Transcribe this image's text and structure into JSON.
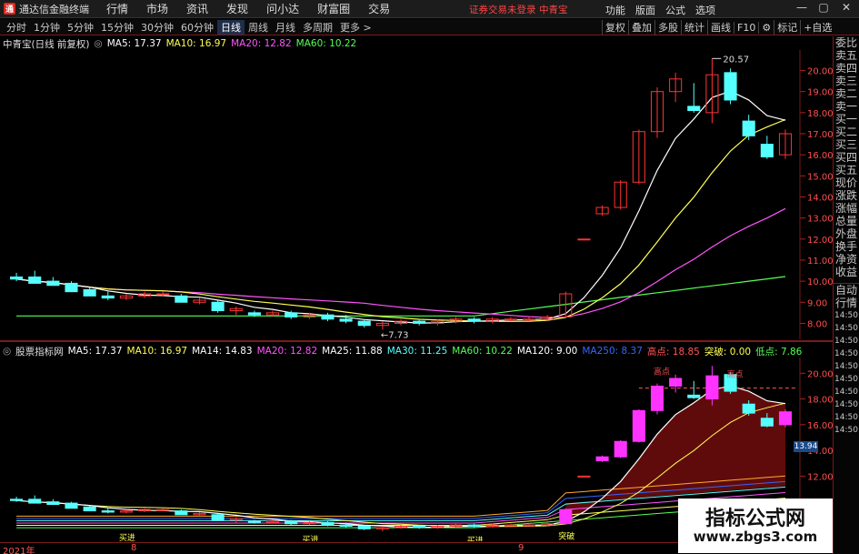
{
  "titlebar": {
    "app_name": "通达信金融终端",
    "menu": [
      "行情",
      "市场",
      "资讯",
      "发现",
      "问小达",
      "财富圈",
      "交易"
    ],
    "notice": "证券交易未登录",
    "stock": "中青宝",
    "right_menu": [
      "功能",
      "版面",
      "公式",
      "选项"
    ],
    "min": "—",
    "max": "▢",
    "close": "✕"
  },
  "toolbar": {
    "periods": [
      "分时",
      "1分钟",
      "5分钟",
      "15分钟",
      "30分钟",
      "60分钟",
      "日线",
      "周线",
      "月线",
      "多周期",
      "更多 >"
    ],
    "active_period": "日线",
    "tools": [
      "复权",
      "叠加",
      "多股",
      "统计",
      "画线",
      "F10",
      "标记",
      "+自选"
    ]
  },
  "right_panel": {
    "top": [
      "委比",
      "卖五",
      "卖四",
      "卖三",
      "卖二",
      "卖一",
      "买一",
      "买二",
      "买三",
      "买四",
      "买五",
      "现价",
      "涨跌",
      "涨幅",
      "总量",
      "外盘",
      "换手",
      "净资",
      "收益"
    ],
    "bottom": [
      "自动",
      "行情",
      "14:50",
      "14:50",
      "14:50",
      "14:50",
      "14:50",
      "14:50",
      "14:50",
      "14:50",
      "14:50",
      "14:50"
    ]
  },
  "main_legend": {
    "title": "中青宝(日线 前复权)",
    "ma5": "MA5: 17.37",
    "ma10": "MA10: 16.97",
    "ma20": "MA20: 12.82",
    "ma60": "MA60: 10.22"
  },
  "sub_legend": {
    "title": "股票指标网",
    "items": [
      {
        "text": "MA5: 17.37",
        "color": "#ffffff"
      },
      {
        "text": "MA10: 16.97",
        "color": "#ffff55"
      },
      {
        "text": "MA14: 14.83",
        "color": "#ffffff"
      },
      {
        "text": "MA20: 12.82",
        "color": "#ff55ff"
      },
      {
        "text": "MA25: 11.88",
        "color": "#ffffff"
      },
      {
        "text": "MA30: 11.25",
        "color": "#55ffff"
      },
      {
        "text": "MA60: 10.22",
        "color": "#55ff55"
      },
      {
        "text": "MA120: 9.00",
        "color": "#ffffff"
      },
      {
        "text": "MA250: 8.37",
        "color": "#3366ff"
      },
      {
        "text": "高点: 18.85",
        "color": "#ff5555"
      },
      {
        "text": "突破: 0.00",
        "color": "#ffff55"
      },
      {
        "text": "低点: 7.86",
        "color": "#55ff55"
      }
    ]
  },
  "main_axis": [
    "20.00",
    "19.00",
    "18.00",
    "17.00",
    "16.00",
    "15.00",
    "14.00",
    "13.00",
    "12.00",
    "11.00",
    "10.00",
    "9.00",
    "8.00"
  ],
  "sub_axis": [
    "20.00",
    "18.00",
    "16.00",
    "14.00",
    "12.00"
  ],
  "sub_value_box": "13.94",
  "annotations": {
    "high": "20.57",
    "low": "7.73",
    "high_mark": "高点",
    "breakout": "突破",
    "buy": "买进"
  },
  "time_axis": [
    "2021年",
    "8",
    "9"
  ],
  "watermark": {
    "line1": "指标公式网",
    "line2": "www.zbgs3.com"
  },
  "chart_data": {
    "type": "candlestick",
    "title": "中青宝(日线 前复权)",
    "ylim": [
      7.5,
      20.8
    ],
    "candles": [
      [
        10.2,
        10.4,
        10.0,
        10.1
      ],
      [
        10.2,
        10.5,
        9.9,
        9.9
      ],
      [
        10.0,
        10.2,
        9.8,
        9.8
      ],
      [
        9.9,
        10.0,
        9.5,
        9.5
      ],
      [
        9.6,
        9.7,
        9.3,
        9.3
      ],
      [
        9.3,
        9.5,
        9.1,
        9.2
      ],
      [
        9.2,
        9.4,
        9.1,
        9.3
      ],
      [
        9.3,
        9.5,
        9.2,
        9.4
      ],
      [
        9.4,
        9.5,
        9.3,
        9.4
      ],
      [
        9.3,
        9.4,
        9.0,
        9.0
      ],
      [
        9.0,
        9.2,
        8.9,
        9.1
      ],
      [
        9.0,
        9.1,
        8.5,
        8.6
      ],
      [
        8.6,
        8.8,
        8.4,
        8.7
      ],
      [
        8.5,
        8.6,
        8.3,
        8.4
      ],
      [
        8.4,
        8.6,
        8.3,
        8.5
      ],
      [
        8.5,
        8.6,
        8.2,
        8.3
      ],
      [
        8.3,
        8.5,
        8.2,
        8.4
      ],
      [
        8.4,
        8.5,
        8.1,
        8.2
      ],
      [
        8.2,
        8.4,
        8.0,
        8.1
      ],
      [
        8.1,
        8.2,
        7.8,
        7.9
      ],
      [
        7.9,
        8.1,
        7.7,
        8.0
      ],
      [
        8.0,
        8.2,
        7.9,
        8.1
      ],
      [
        8.1,
        8.2,
        7.9,
        8.0
      ],
      [
        8.0,
        8.2,
        7.9,
        8.1
      ],
      [
        8.1,
        8.3,
        8.0,
        8.2
      ],
      [
        8.2,
        8.3,
        8.0,
        8.1
      ],
      [
        8.1,
        8.3,
        8.0,
        8.2
      ],
      [
        8.2,
        8.3,
        8.1,
        8.2
      ],
      [
        8.2,
        8.3,
        8.1,
        8.2
      ],
      [
        8.2,
        8.4,
        8.1,
        8.3
      ],
      [
        8.3,
        9.5,
        8.3,
        9.4
      ],
      [
        12.0,
        12.0,
        12.0,
        12.0
      ],
      [
        13.2,
        13.6,
        13.1,
        13.5
      ],
      [
        13.5,
        14.8,
        13.4,
        14.7
      ],
      [
        14.7,
        17.2,
        14.6,
        17.1
      ],
      [
        17.1,
        19.2,
        16.8,
        19.0
      ],
      [
        19.0,
        19.9,
        18.5,
        19.6
      ],
      [
        18.3,
        19.4,
        18.0,
        18.1
      ],
      [
        18.0,
        20.57,
        17.5,
        19.8
      ],
      [
        19.9,
        20.1,
        18.4,
        18.6
      ],
      [
        17.6,
        17.9,
        16.7,
        16.9
      ],
      [
        16.5,
        16.9,
        15.8,
        15.9
      ],
      [
        16.0,
        17.2,
        15.8,
        17.0
      ]
    ]
  },
  "colors": {
    "up": "#ff3333",
    "down": "#55ffff",
    "ma5": "#ffffff",
    "ma10": "#ffff55",
    "ma20": "#ff55ff",
    "ma60": "#55ff55",
    "border": "#7a1a1a"
  }
}
